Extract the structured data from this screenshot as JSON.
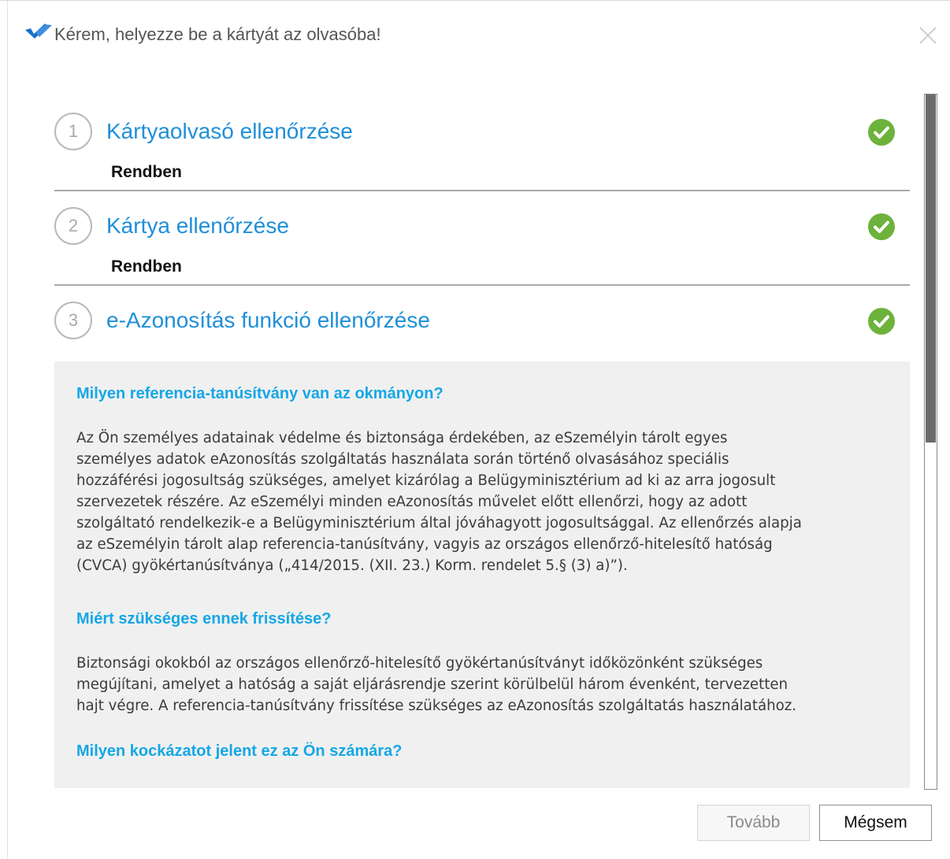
{
  "window": {
    "title": "Kérem, helyezze be a kártyát az olvasóba!"
  },
  "steps": [
    {
      "number": "1",
      "title": "Kártyaolvasó ellenőrzése",
      "status": "Rendben",
      "state": "ok"
    },
    {
      "number": "2",
      "title": "Kártya ellenőrzése",
      "status": "Rendben",
      "state": "ok"
    },
    {
      "number": "3",
      "title": "e-Azonosítás funkció ellenőrzése",
      "state": "ok"
    }
  ],
  "info": {
    "sections": [
      {
        "heading": "Milyen referencia-tanúsítvány van az okmányon?",
        "lines": [
          "Az Ön személyes adatainak védelme és biztonsága érdekében, az eSzemélyin tárolt egyes",
          "személyes adatok eAzonosítás szolgáltatás használata során történő olvasásához speciális",
          "hozzáférési jogosultság szükséges, amelyet kizárólag a Belügyminisztérium ad ki az arra jogosult",
          "szervezetek részére. Az eSzemélyi minden eAzonosítás művelet előtt ellenőrzi, hogy az adott",
          "szolgáltató rendelkezik-e a Belügyminisztérium által jóváhagyott jogosultsággal. Az ellenőrzés alapja",
          "az eSzemélyin tárolt alap referencia-tanúsítvány, vagyis az országos ellenőrző-hitelesítő hatóság",
          "(CVCA) gyökértanúsítványa („414/2015. (XII. 23.) Korm. rendelet 5.§ (3) a)”)."
        ]
      },
      {
        "heading": "Miért szükséges ennek frissítése?",
        "lines": [
          "Biztonsági okokból az országos ellenőrző-hitelesítő gyökértanúsítványt időközönként szükséges",
          "megújítani, amelyet a hatóság a saját eljárásrendje szerint körülbelül három évenként, tervezetten",
          "hajt végre. A referencia-tanúsítvány frissítése szükséges az eAzonosítás szolgáltatás használatához."
        ]
      },
      {
        "heading": "Milyen kockázatot jelent ez az Ön számára?"
      }
    ]
  },
  "buttons": {
    "next_label": "Tovább",
    "cancel_label": "Mégsem"
  },
  "colors": {
    "step_title": "#1f8fd8",
    "info_heading": "#15a7e6",
    "check_green": "#6cb23b",
    "panel_bg": "#f0f0f0",
    "logo_blue": "#1b6fc8"
  },
  "icons": {
    "logo": "ez-logo-icon",
    "close": "close-icon",
    "check": "check-circle-icon"
  },
  "scroll": {
    "visible_fraction": 0.5,
    "position_fraction": 0.0
  }
}
